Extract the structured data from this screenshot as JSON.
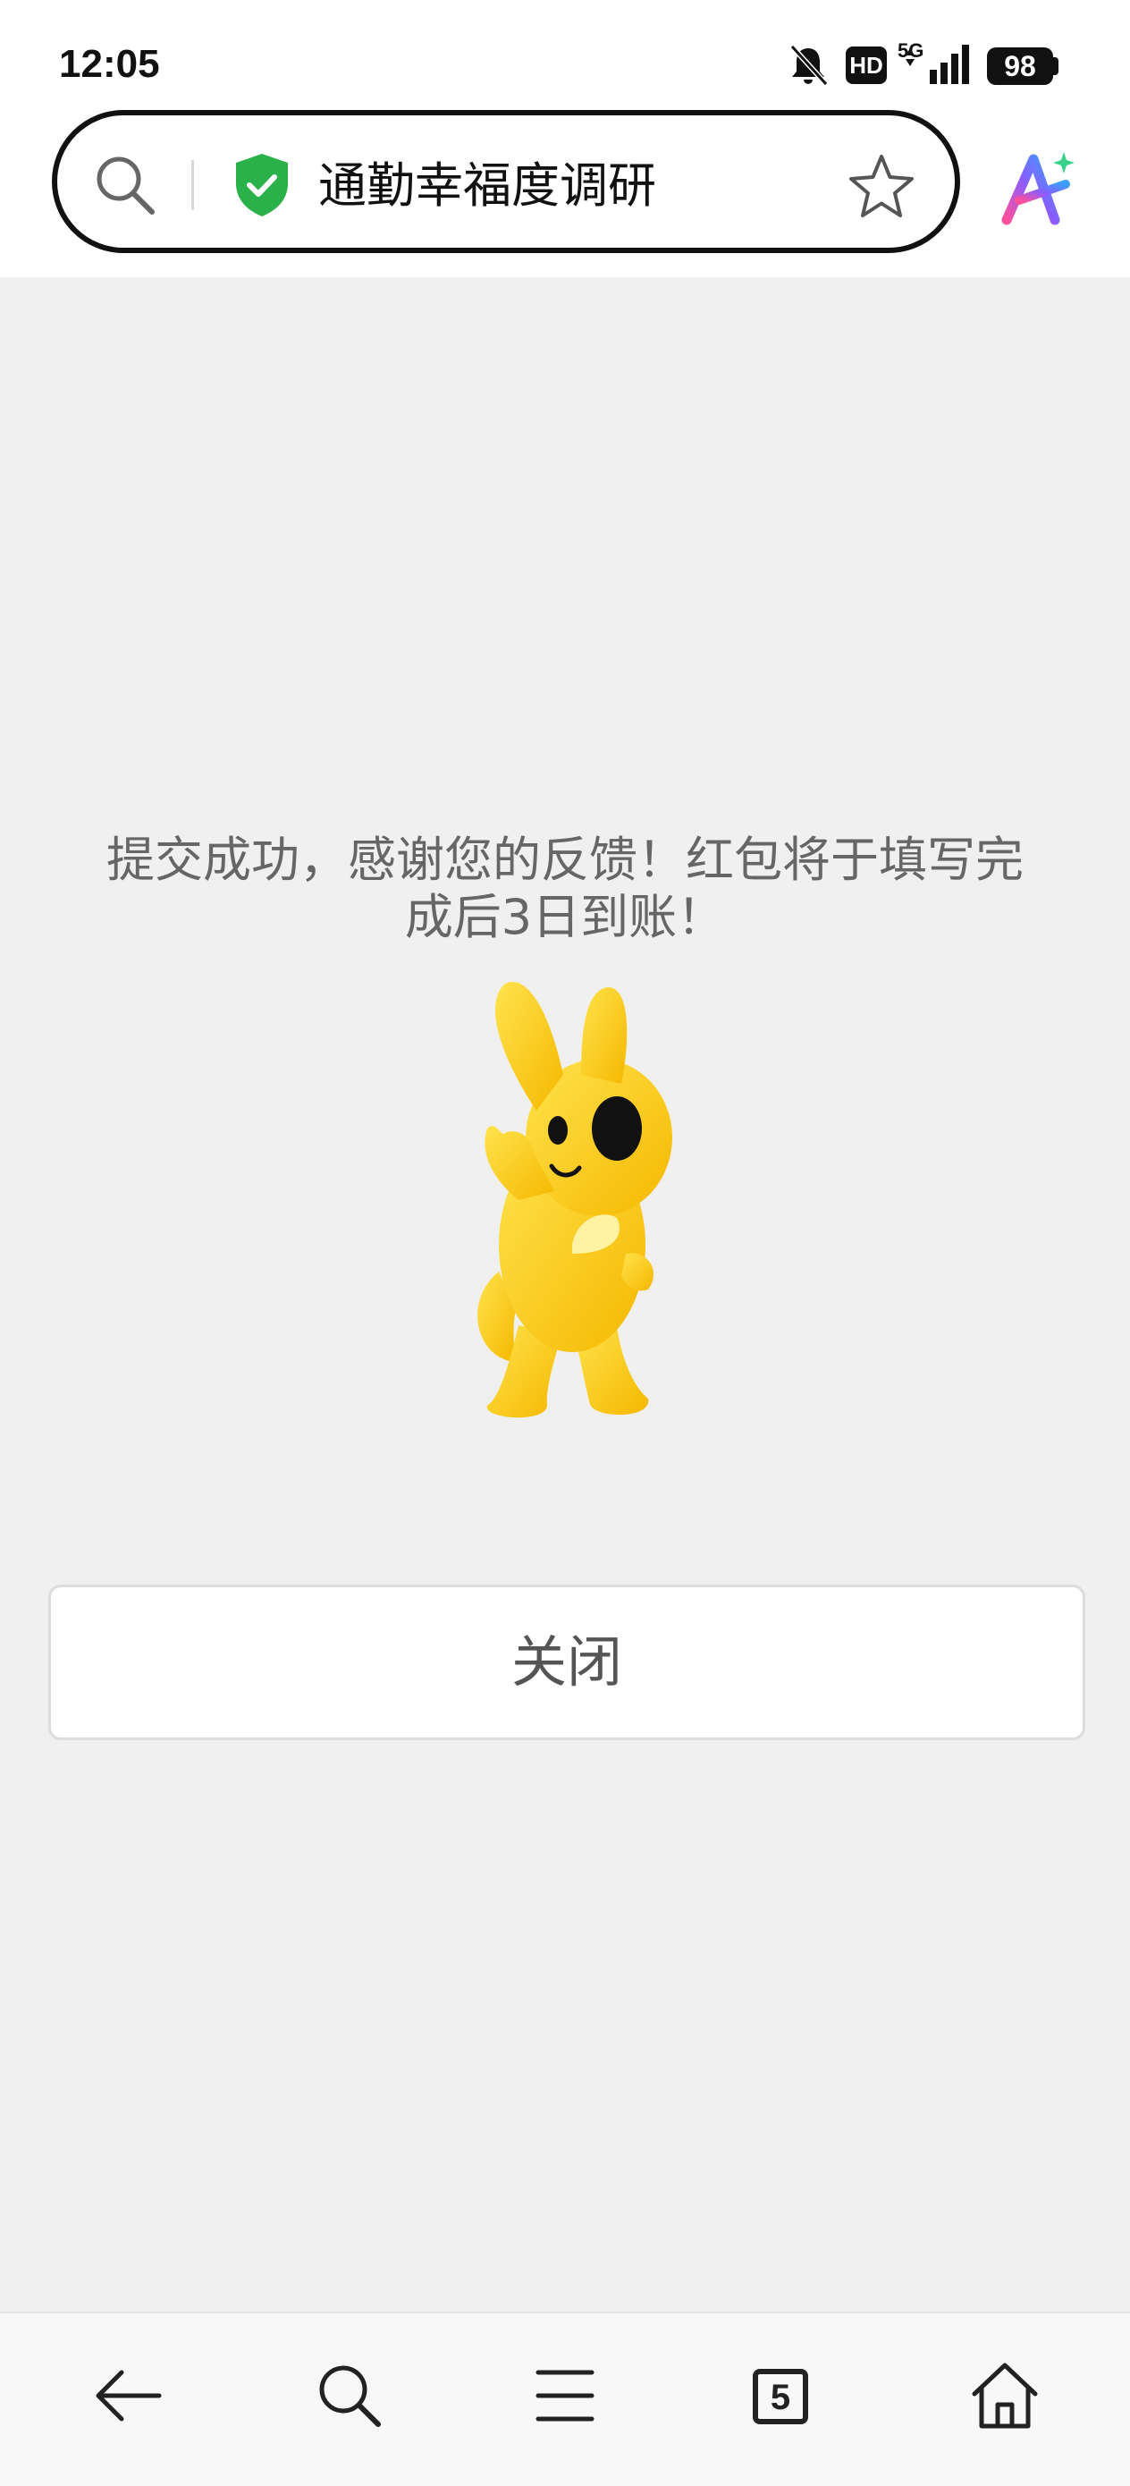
{
  "status_bar": {
    "time": "12:05",
    "network": "5G",
    "hd_badge": "HD",
    "battery": "98",
    "icons": [
      "bell-muted-icon",
      "hd-icon",
      "signal-icon",
      "battery-icon"
    ]
  },
  "address_bar": {
    "title": "通勤幸福度调研",
    "icons": [
      "search-icon",
      "shield-check-icon",
      "star-icon",
      "ai-assistant-icon"
    ],
    "shield_color": "#2bb14a"
  },
  "main": {
    "message": "提交成功，感谢您的反馈！红包将于填写完成后3日到账！",
    "close_label": "关闭",
    "mascot": "yellow-rabbit-mascot"
  },
  "bottom_nav": {
    "tab_count": "5",
    "items": [
      "back-icon",
      "search-icon",
      "menu-icon",
      "tabs-icon",
      "home-icon"
    ]
  }
}
